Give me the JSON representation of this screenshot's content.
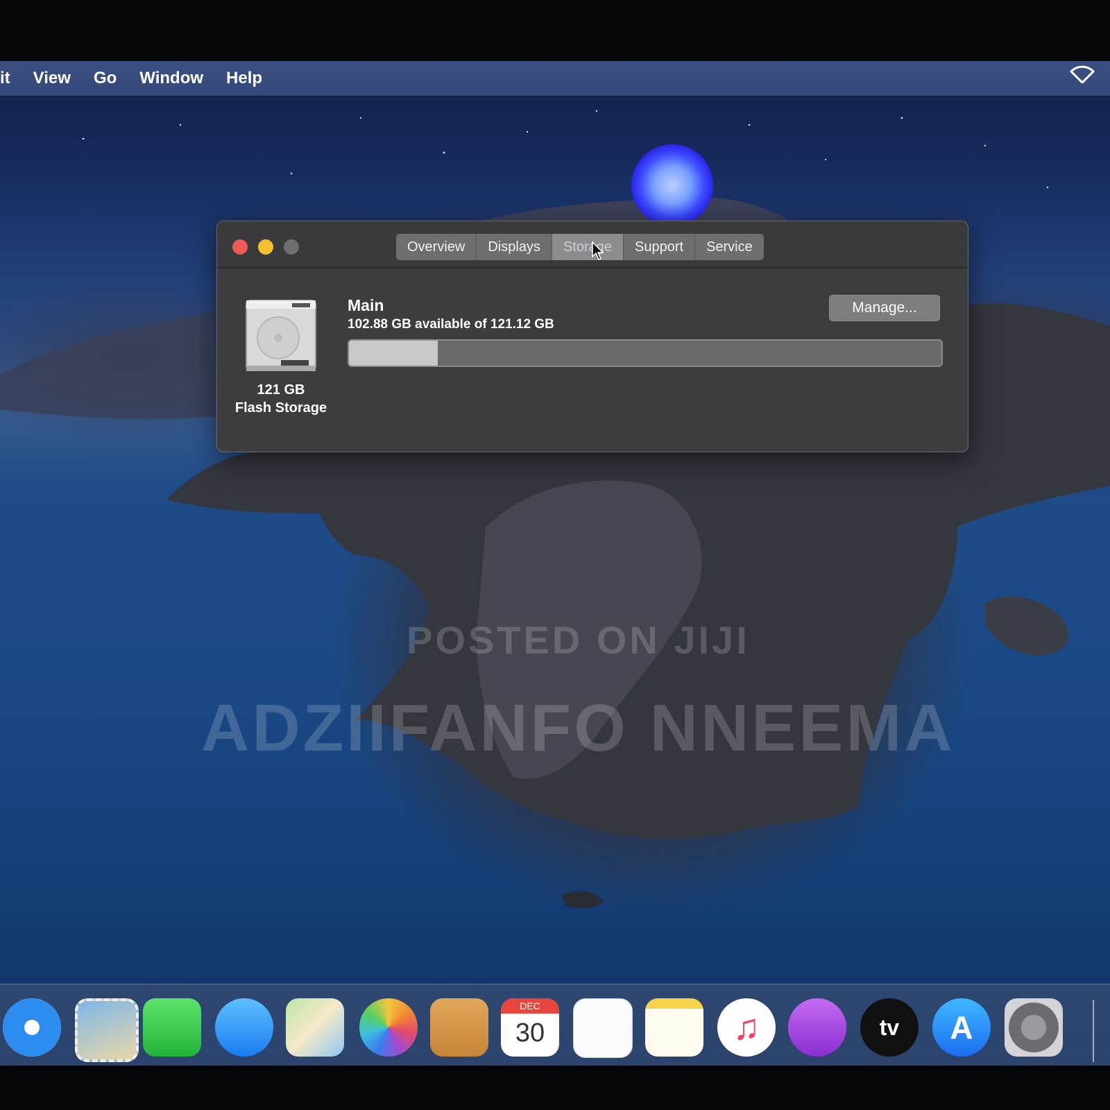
{
  "menubar": {
    "items": [
      "it",
      "View",
      "Go",
      "Window",
      "Help"
    ],
    "wifi_icon": "wifi-icon"
  },
  "window": {
    "tabs": [
      "Overview",
      "Displays",
      "Storage",
      "Support",
      "Service"
    ],
    "active_tab": "Storage",
    "disk": {
      "icon": "hard-drive-icon",
      "size": "121 GB",
      "kind": "Flash Storage"
    },
    "volume": {
      "name": "Main",
      "available": "102.88 GB available of 121.12 GB",
      "used_fraction": 0.15
    },
    "manage_label": "Manage..."
  },
  "watermark": {
    "line1": "POSTED ON JIJI",
    "line2": "ADZIIFANFO NNEEMA"
  },
  "dock": {
    "apps": [
      "safari-icon",
      "mail-icon",
      "facetime-icon",
      "messages-icon",
      "maps-icon",
      "photos-icon",
      "contacts-icon",
      "calendar-icon",
      "reminders-icon",
      "notes-icon",
      "music-icon",
      "podcasts-icon",
      "apple-tv-icon",
      "app-store-icon",
      "system-preferences-icon"
    ],
    "calendar": {
      "month": "DEC",
      "day": "30"
    },
    "tv_label": "tv"
  },
  "colors": {
    "close": "#ec5b55",
    "minimize": "#f4c12e",
    "zoom": "#6d6d70",
    "menubar": "#3a4d80"
  }
}
